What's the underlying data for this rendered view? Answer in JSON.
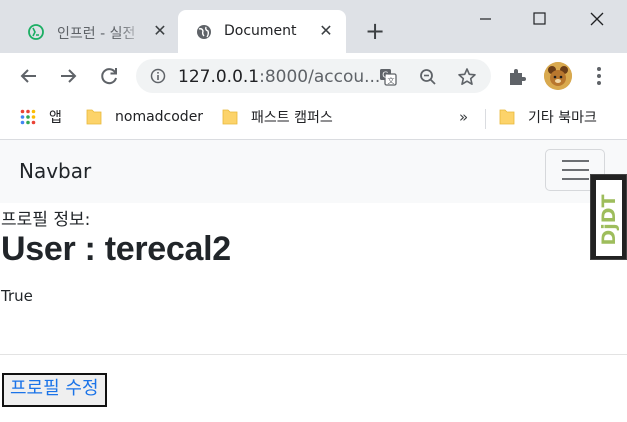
{
  "browser": {
    "tabs": [
      {
        "title": "인프런 - 실전",
        "active": false
      },
      {
        "title": "Document",
        "active": true
      }
    ],
    "close_glyph": "✕",
    "new_tab_glyph": "+",
    "address": {
      "host": "127.0.0.1",
      "rest": ":8000/accou..."
    },
    "bookmarks": [
      {
        "label": "앱",
        "icon": "apps-grid-icon"
      },
      {
        "label": "nomadcoder",
        "icon": "folder-icon"
      },
      {
        "label": "패스트 캠퍼스",
        "icon": "folder-icon"
      },
      {
        "label": "기타 북마크",
        "icon": "folder-icon"
      }
    ],
    "bookmarks_overflow": "»"
  },
  "page": {
    "navbar_brand": "Navbar",
    "profile_label": "프로필 정보:",
    "user_heading": "User : terecal2",
    "status_text": "True",
    "edit_button": "프로필 수정",
    "debug_toolbar_label": "DjDT"
  },
  "colors": {
    "tabstrip_bg": "#dee1e6",
    "navbar_bg": "#f8f9fa",
    "link_blue": "#1a73e8",
    "djdt_green": "#9ebd5c"
  }
}
